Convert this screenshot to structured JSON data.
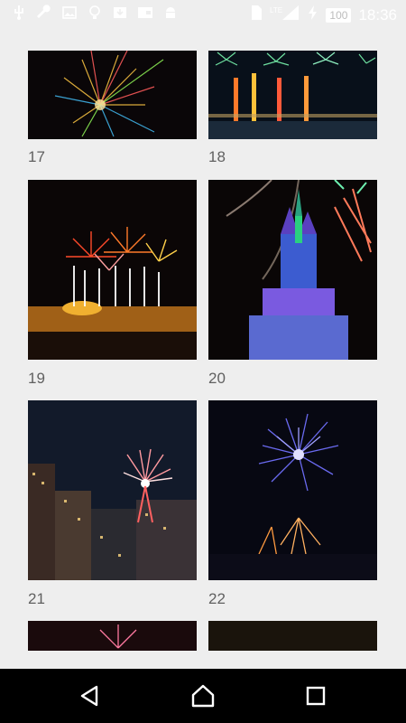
{
  "status_bar": {
    "icons": [
      "usb-icon",
      "wrench-icon",
      "image-icon",
      "lightbulb-icon",
      "download-icon",
      "wallet-icon",
      "android-icon",
      "sim-icon",
      "lte-signal-icon",
      "charging-icon"
    ],
    "battery": "100",
    "time": "18:36",
    "network_label": "LTE"
  },
  "gallery": {
    "items": [
      {
        "label": "17"
      },
      {
        "label": "18"
      },
      {
        "label": "19"
      },
      {
        "label": "20"
      },
      {
        "label": "21"
      },
      {
        "label": "22"
      }
    ]
  },
  "nav_bar": {
    "icons": [
      "back-icon",
      "home-icon",
      "recents-icon"
    ]
  }
}
